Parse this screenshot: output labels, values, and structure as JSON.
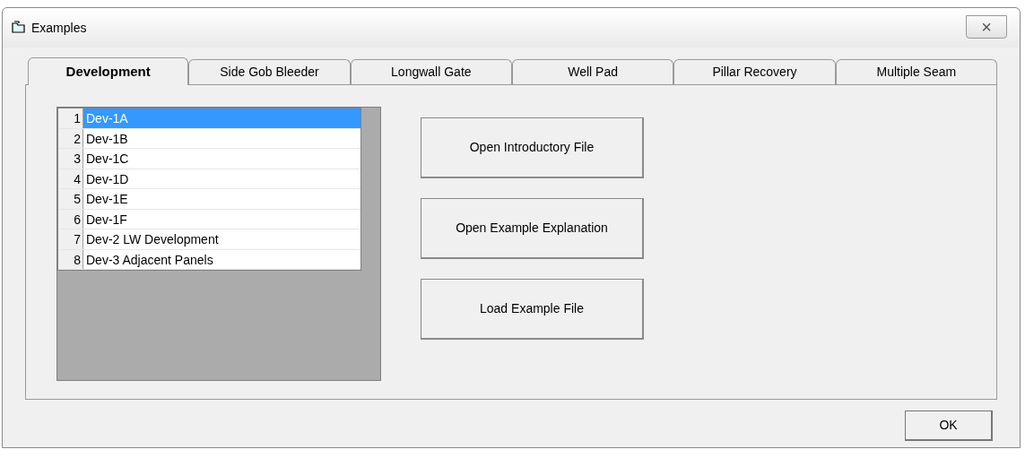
{
  "window": {
    "title": "Examples",
    "close": "×"
  },
  "tabs": [
    {
      "label": "Development",
      "selected": true
    },
    {
      "label": "Side Gob Bleeder",
      "selected": false
    },
    {
      "label": "Longwall Gate",
      "selected": false
    },
    {
      "label": "Well Pad",
      "selected": false
    },
    {
      "label": "Pillar Recovery",
      "selected": false
    },
    {
      "label": "Multiple Seam",
      "selected": false
    }
  ],
  "grid": {
    "rows": [
      {
        "number": "1",
        "name": "Dev-1A",
        "selected": true
      },
      {
        "number": "2",
        "name": "Dev-1B",
        "selected": false
      },
      {
        "number": "3",
        "name": "Dev-1C",
        "selected": false
      },
      {
        "number": "4",
        "name": "Dev-1D",
        "selected": false
      },
      {
        "number": "5",
        "name": "Dev-1E",
        "selected": false
      },
      {
        "number": "6",
        "name": "Dev-1F",
        "selected": false
      },
      {
        "number": "7",
        "name": "Dev-2 LW Development",
        "selected": false
      },
      {
        "number": "8",
        "name": "Dev-3 Adjacent Panels",
        "selected": false
      }
    ]
  },
  "buttons": [
    "Open Introductory File",
    "Open Example Explanation",
    "Load Example File"
  ],
  "ok_button": "OK"
}
